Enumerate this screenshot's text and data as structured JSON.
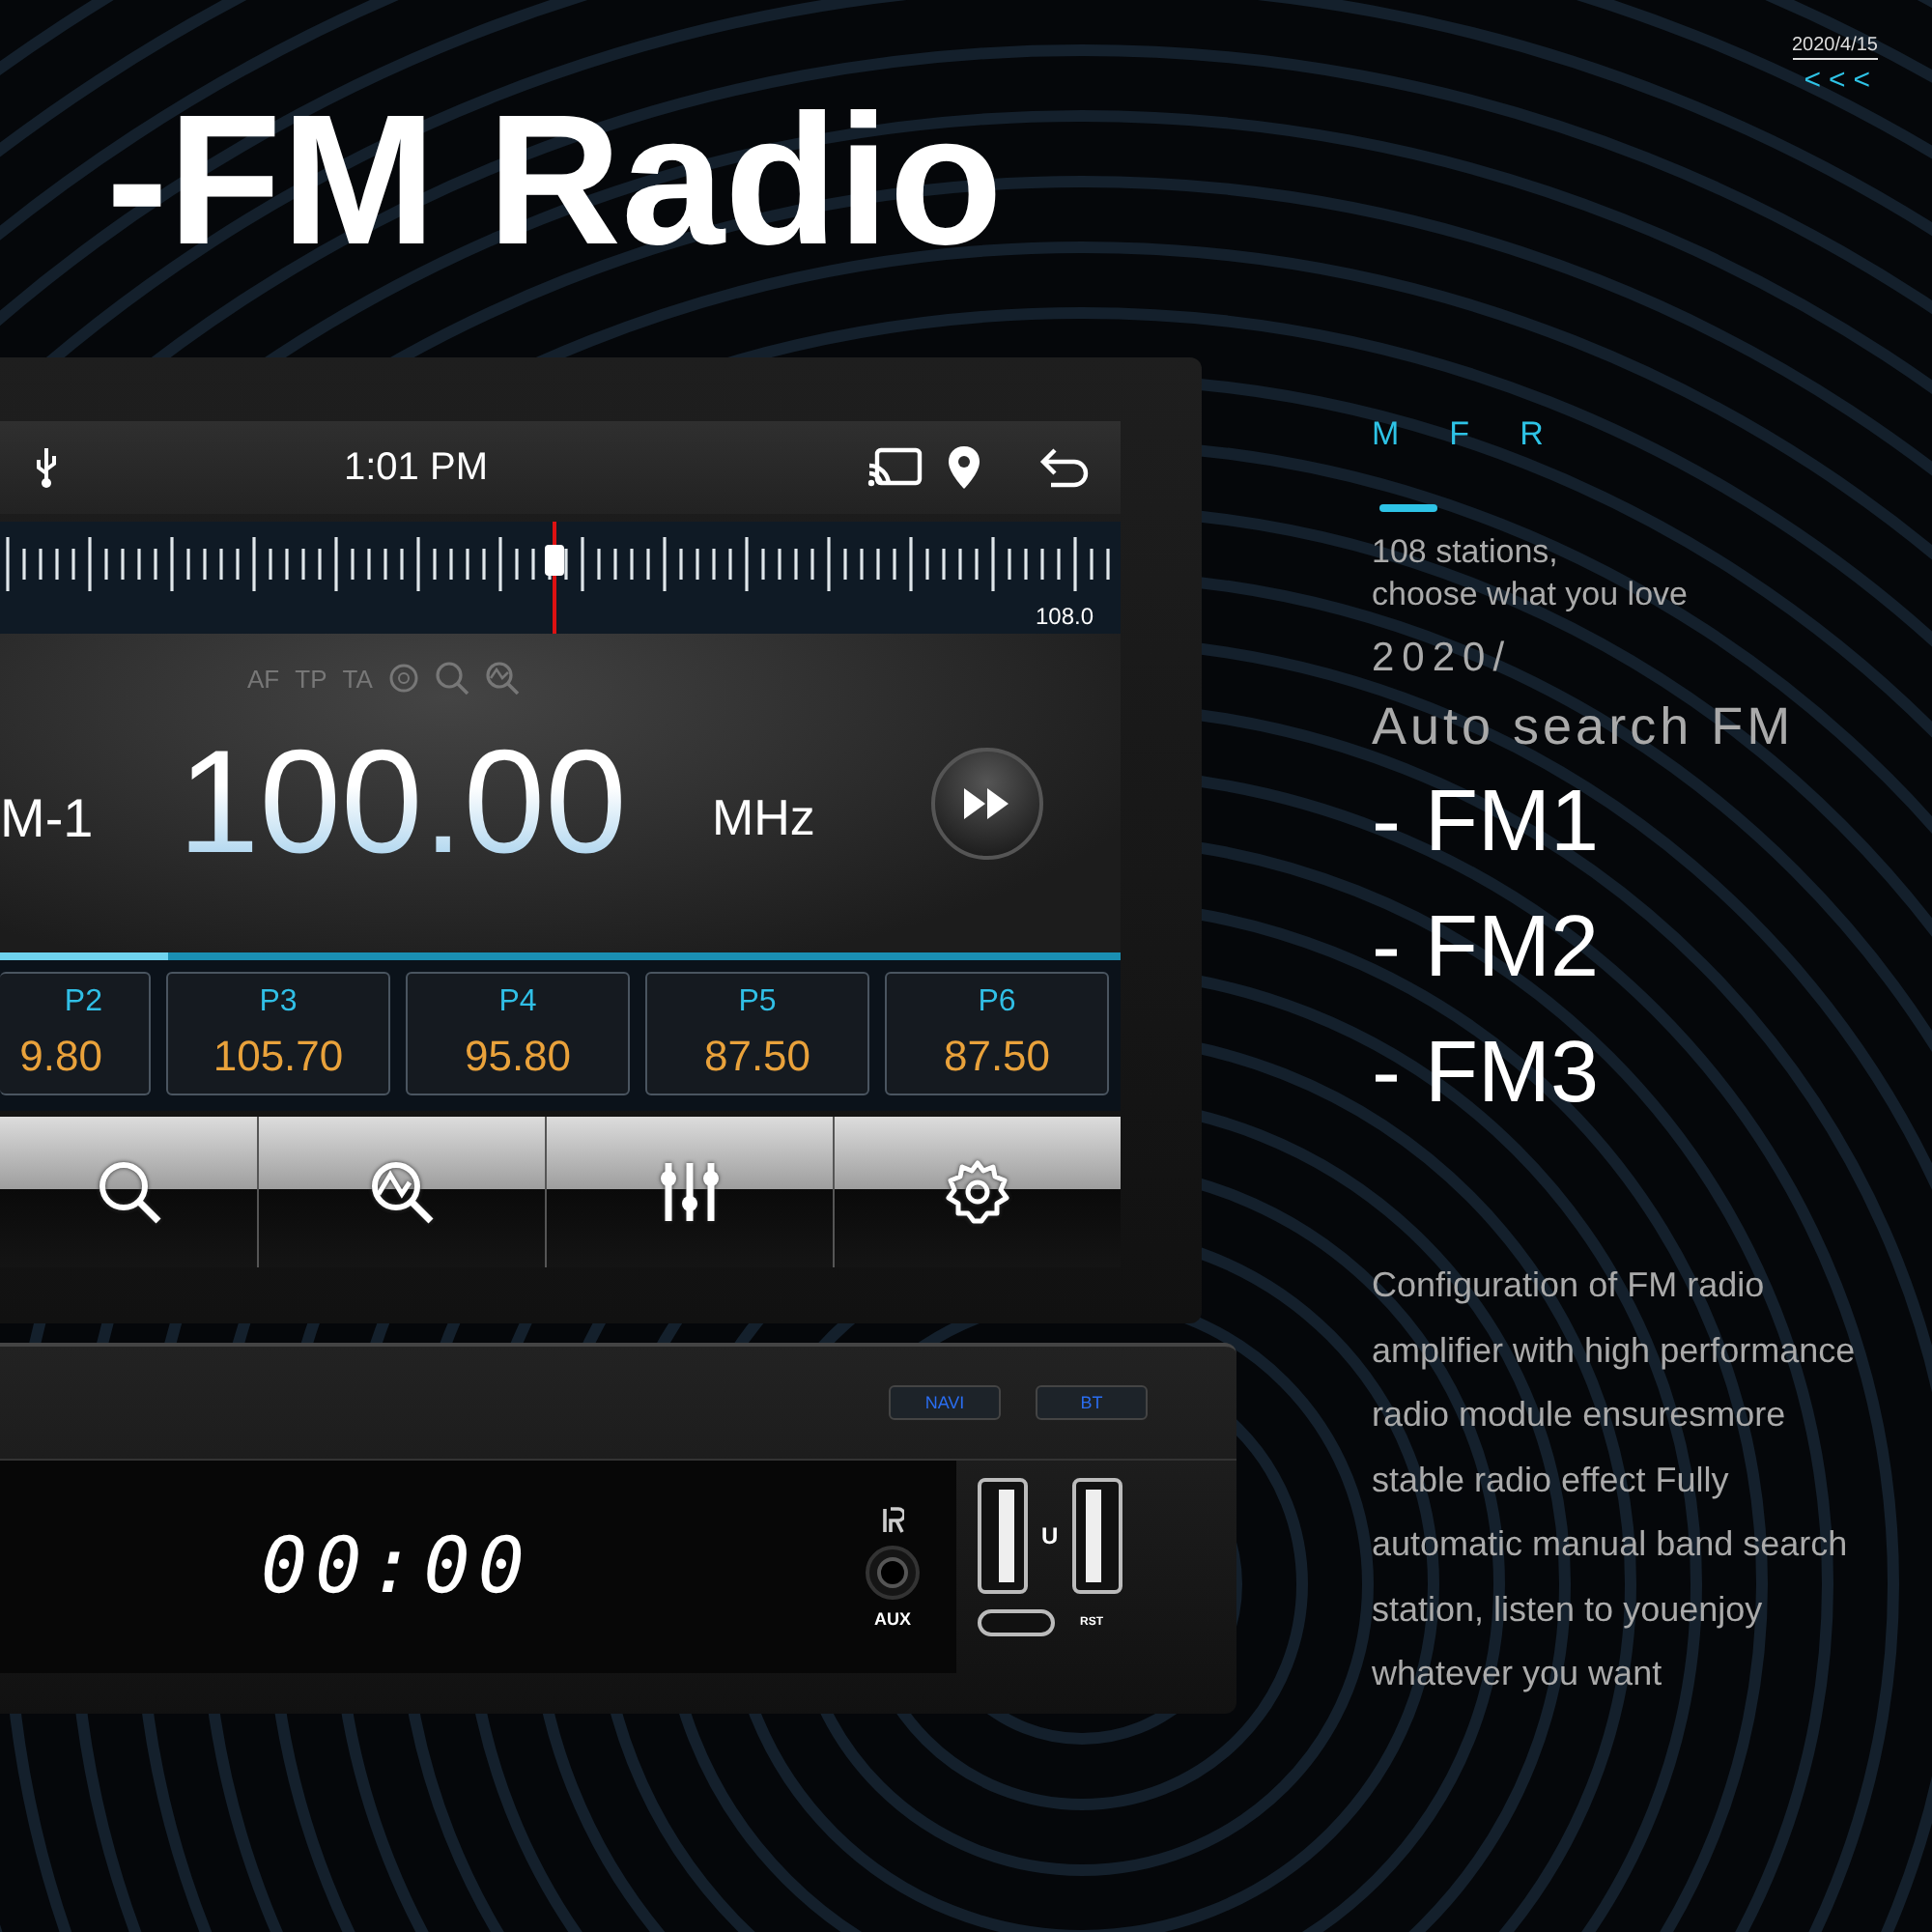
{
  "headline": "-FM Radio",
  "date": "2020/4/15",
  "chevrons": "<<<",
  "device": {
    "status_bar": {
      "time": "1:01 PM"
    },
    "tuning_scale": {
      "end_label": "108.0"
    },
    "rds_flags": [
      "AF",
      "TP",
      "TA"
    ],
    "band": "M-1",
    "frequency": "100.00",
    "unit": "MHz",
    "presets": [
      {
        "label": "P2",
        "frequency": "9.80"
      },
      {
        "label": "P3",
        "frequency": "105.70"
      },
      {
        "label": "P4",
        "frequency": "95.80"
      },
      {
        "label": "P5",
        "frequency": "87.50"
      },
      {
        "label": "P6",
        "frequency": "87.50"
      }
    ],
    "toolbar": [
      {
        "kind": "search"
      },
      {
        "kind": "scan"
      },
      {
        "kind": "equalizer"
      },
      {
        "kind": "settings"
      }
    ],
    "front_panel": {
      "buttons": [
        "NAVI",
        "BT"
      ],
      "clock": "00:00",
      "aux_label": "AUX",
      "usb_label": "U",
      "reset_label": "RST"
    }
  },
  "features": {
    "letters": [
      "M",
      "F",
      "R"
    ],
    "tagline": [
      "108 stations,",
      "choose what you love"
    ],
    "year": "2020/",
    "heading": "Auto search FM",
    "bands": [
      "- FM1",
      "- FM2",
      "- FM3"
    ],
    "description": "Configuration of FM radio amplifier with high performance radio module ensuresmore stable radio effect Fully automatic manual band search station, listen to youenjoy whatever you want"
  }
}
